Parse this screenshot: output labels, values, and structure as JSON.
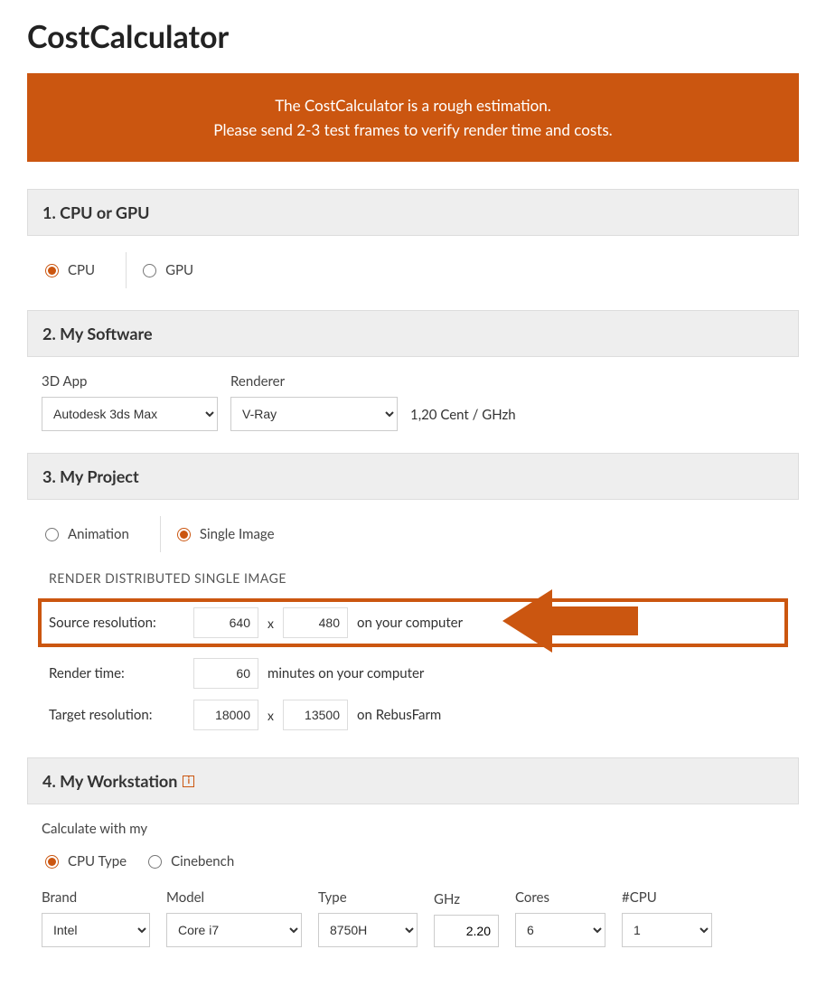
{
  "title": "CostCalculator",
  "banner": {
    "line1": "The CostCalculator is a rough estimation.",
    "line2": "Please send 2-3 test frames to verify render time and costs."
  },
  "sections": {
    "s1": {
      "title": "1. CPU or GPU",
      "cpu": "CPU",
      "gpu": "GPU"
    },
    "s2": {
      "title": "2. My Software",
      "app_label": "3D App",
      "app_value": "Autodesk 3ds Max",
      "renderer_label": "Renderer",
      "renderer_value": "V-Ray",
      "price": "1,20 Cent / GHzh"
    },
    "s3": {
      "title": "3. My Project",
      "animation": "Animation",
      "single": "Single Image",
      "sub": "RENDER DISTRIBUTED SINGLE IMAGE",
      "src_label": "Source resolution:",
      "src_w": "640",
      "src_h": "480",
      "src_suffix": "on your computer",
      "rt_label": "Render time:",
      "rt_val": "60",
      "rt_suffix": "minutes on your computer",
      "tgt_label": "Target resolution:",
      "tgt_w": "18000",
      "tgt_h": "13500",
      "tgt_suffix": "on RebusFarm",
      "sep": "x"
    },
    "s4": {
      "title": "4. My Workstation",
      "calc_label": "Calculate with my",
      "cpu_type": "CPU Type",
      "cinebench": "Cinebench",
      "brand_label": "Brand",
      "brand_value": "Intel",
      "model_label": "Model",
      "model_value": "Core i7",
      "type_label": "Type",
      "type_value": "8750H",
      "ghz_label": "GHz",
      "ghz_value": "2.20",
      "cores_label": "Cores",
      "cores_value": "6",
      "ncpu_label": "#CPU",
      "ncpu_value": "1"
    }
  }
}
